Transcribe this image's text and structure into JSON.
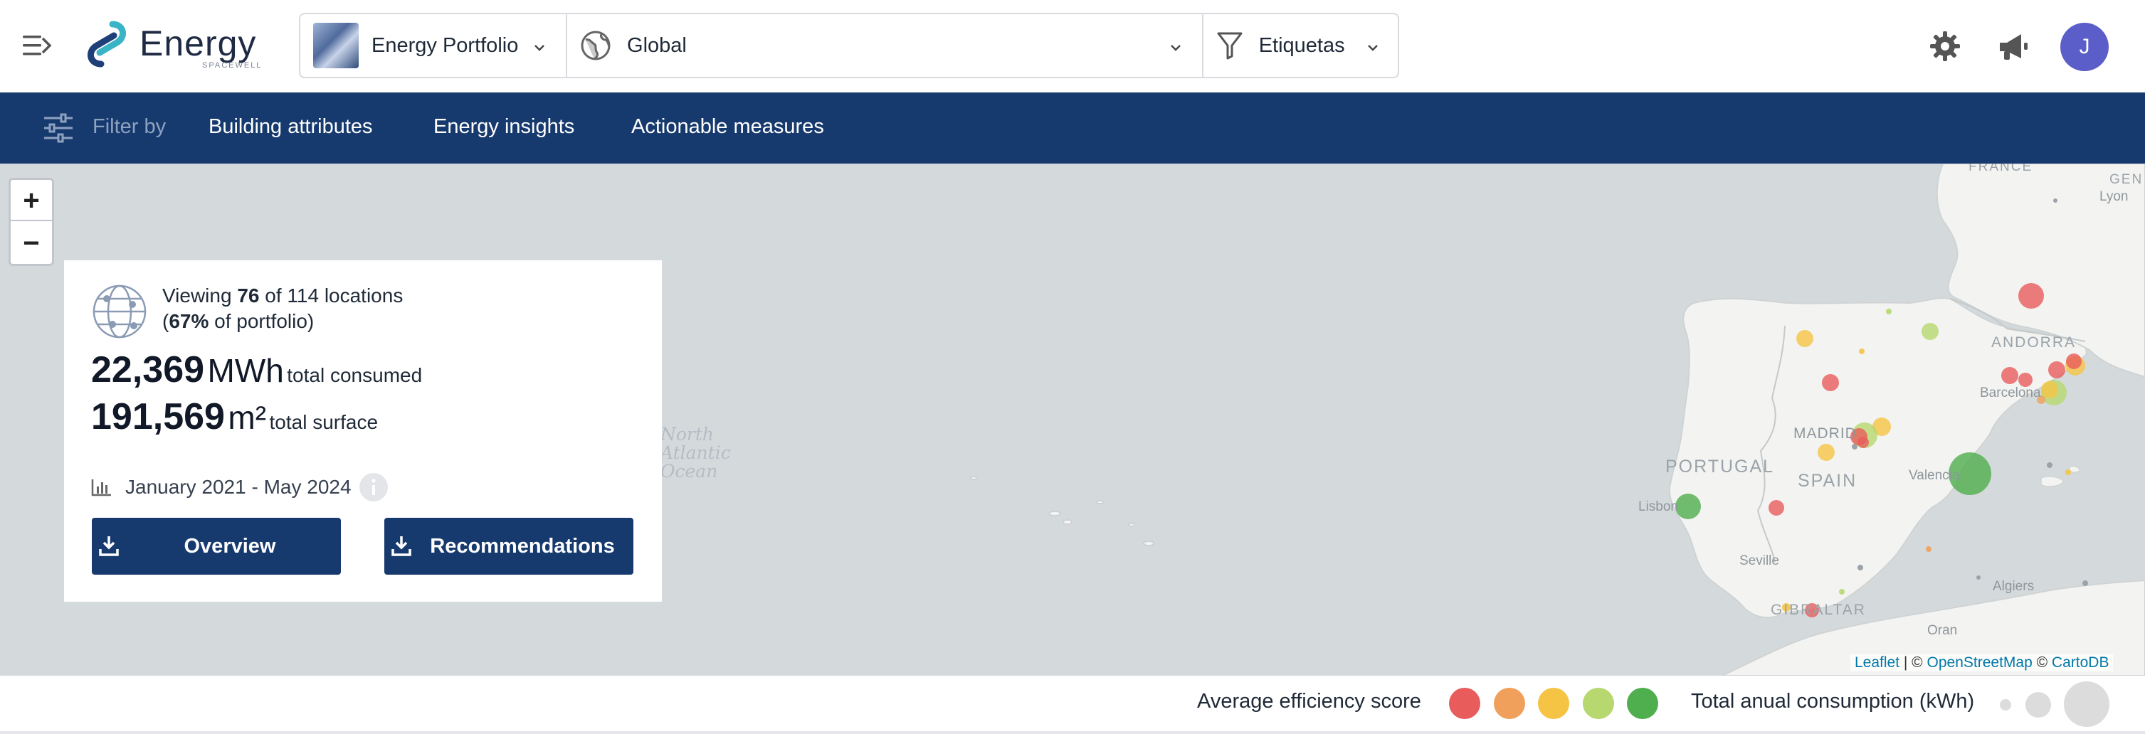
{
  "app": {
    "brand_name": "Energy",
    "brand_sub": "SPACEWELL"
  },
  "header": {
    "portfolio_label": "Energy Portfolio",
    "scope_label": "Global",
    "tags_label": "Etiquetas",
    "avatar_initial": "J"
  },
  "filterbar": {
    "filter_by": "Filter by",
    "items": [
      {
        "label": "Building attributes"
      },
      {
        "label": "Energy insights"
      },
      {
        "label": "Actionable measures"
      }
    ]
  },
  "map": {
    "zoom_in": "+",
    "zoom_out": "−",
    "ocean_label_1": "North",
    "ocean_label_2": "Atlantic",
    "ocean_label_3": "Ocean",
    "countries": {
      "portugal": "PORTUGAL",
      "spain": "SPAIN",
      "andorra": "ANDORRA",
      "gibraltar": "GIBRALTAR",
      "france": "FRANCE",
      "geneva": "GEN"
    },
    "cities": {
      "madrid": "MADRID",
      "barcelona": "Barcelona",
      "valencia": "Valencia",
      "lisbon": "Lisbon",
      "seville": "Seville",
      "algiers": "Algiers",
      "oran": "Oran",
      "lyon": "Lyon"
    },
    "attribution": {
      "leaflet": "Leaflet",
      "sep1": " | © ",
      "osm": "OpenStreetMap",
      "sep2": " © ",
      "carto": "CartoDB"
    }
  },
  "summary": {
    "viewing_prefix": "Viewing ",
    "viewing_count": "76",
    "viewing_suffix": " of 114 locations",
    "pct_open": "(",
    "pct_value": "67%",
    "pct_suffix": " of portfolio)",
    "consumed_value": "22,369",
    "consumed_unit": "MWh",
    "consumed_label": "total consumed",
    "surface_value": "191,569",
    "surface_unit": "m²",
    "surface_label": "total surface",
    "period": "January 2021 - May 2024",
    "overview_button": "Overview",
    "recommendations_button": "Recommendations"
  },
  "legend": {
    "efficiency_title": "Average efficiency score",
    "efficiency_colors": [
      "#e85c5c",
      "#f0a05a",
      "#f5c445",
      "#b6d86f",
      "#4fae4e"
    ],
    "consumption_title": "Total anual consumption (kWh)"
  },
  "colors": {
    "navy": "#173a6e",
    "map_water": "#d4dadc",
    "map_land": "#f3f3f1",
    "avatar": "#5b5ec9"
  }
}
